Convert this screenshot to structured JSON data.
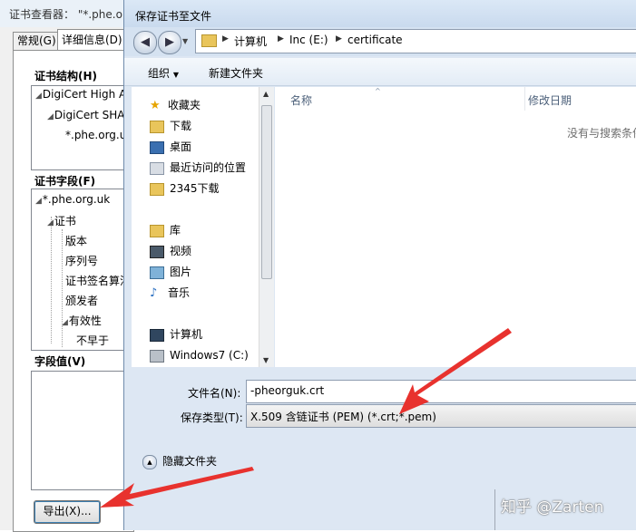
{
  "background_window": {
    "title": "证书查看器： \"*.phe.o",
    "tabs": [
      {
        "label": "常规(G)"
      },
      {
        "label": "详细信息(D)"
      }
    ],
    "cert_path_label": "证书结构(H)",
    "cert_path": [
      "DigiCert High A",
      "DigiCert SHA",
      "*.phe.org.u"
    ],
    "fields_label": "证书字段(F)",
    "fields": [
      "*.phe.org.uk",
      "证书",
      "版本",
      "序列号",
      "证书签名算法",
      "颁发者",
      "有效性",
      "不早于"
    ],
    "value_label": "字段值(V)",
    "export_button": "导出(X)..."
  },
  "dialog": {
    "title": "保存证书至文件",
    "breadcrumbs": [
      "计算机",
      "Inc (E:)",
      "certificate"
    ],
    "toolbar": {
      "organize": "组织",
      "new_folder": "新建文件夹"
    },
    "nav": {
      "favorites": {
        "label": "收藏夹",
        "items": [
          "下载",
          "桌面",
          "最近访问的位置",
          "2345下载"
        ]
      },
      "libraries": {
        "label": "库",
        "items": [
          "视频",
          "图片",
          "音乐"
        ]
      },
      "computer": {
        "label": "计算机",
        "items": [
          "Windows7 (C:)"
        ]
      }
    },
    "columns": {
      "name": "名称",
      "date": "修改日期"
    },
    "empty_message": "没有与搜索条件",
    "filename_label": "文件名(N):",
    "filename_value": "-pheorguk.crt",
    "filetype_label": "保存类型(T):",
    "filetype_value": "X.509 含链证书 (PEM) (*.crt;*.pem)",
    "hide_folders": "隐藏文件夹"
  },
  "watermark": "知乎 @Zarten",
  "colors": {
    "annotation_arrow": "#e8322e"
  }
}
